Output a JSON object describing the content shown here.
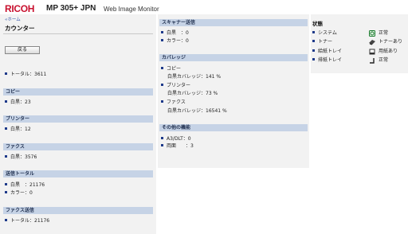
{
  "header": {
    "logo": "RICOH",
    "model": "MP 305+ JPN",
    "app_title": "Web Image Monitor"
  },
  "left": {
    "breadcrumb": "«ホーム",
    "page_title": "カウンター",
    "back_button": "戻る",
    "total": "トータル：3611",
    "copy": {
      "header": "コピー",
      "rows": [
        "白黒：23"
      ]
    },
    "printer": {
      "header": "プリンター",
      "rows": [
        "白黒：12"
      ]
    },
    "fax": {
      "header": "ファクス",
      "rows": [
        "白黒：3576"
      ]
    },
    "send_total": {
      "header": "送信トータル",
      "rows": [
        "白黒　：21176",
        "カラー：0"
      ]
    },
    "fax_send": {
      "header": "ファクス送信",
      "rows": [
        "トータル：21176"
      ]
    }
  },
  "middle": {
    "scanner_send": {
      "header": "スキャナー送信",
      "rows": [
        "白黒　：0",
        "カラー：0"
      ]
    },
    "coverage": {
      "header": "カバレッジ",
      "copy_label": "コピー",
      "copy_value": "白黒カバレッジ：141 %",
      "printer_label": "プリンター",
      "printer_value": "白黒カバレッジ：73 %",
      "fax_label": "ファクス",
      "fax_value": "白黒カバレッジ：16541 %"
    },
    "other": {
      "header": "その他の機能",
      "rows": [
        "A3/DLT：0",
        "両面　　：3"
      ]
    }
  },
  "status": {
    "title": "状態",
    "items": [
      {
        "label": "システム",
        "value": "正常",
        "icon": "status-ok-icon"
      },
      {
        "label": "トナー",
        "value": "トナーあり",
        "icon": "toner-icon"
      },
      {
        "label": "給紙トレイ",
        "value": "用紙あり",
        "icon": "paper-icon"
      },
      {
        "label": "排紙トレイ",
        "value": "正常",
        "icon": "output-tray-icon"
      }
    ]
  },
  "colors": {
    "brand": "#c8102e",
    "section_header": "#c6d3e6",
    "panel": "#f2f2f2",
    "bullet": "#1e3a8a",
    "ok_green": "#1a7a2e"
  }
}
